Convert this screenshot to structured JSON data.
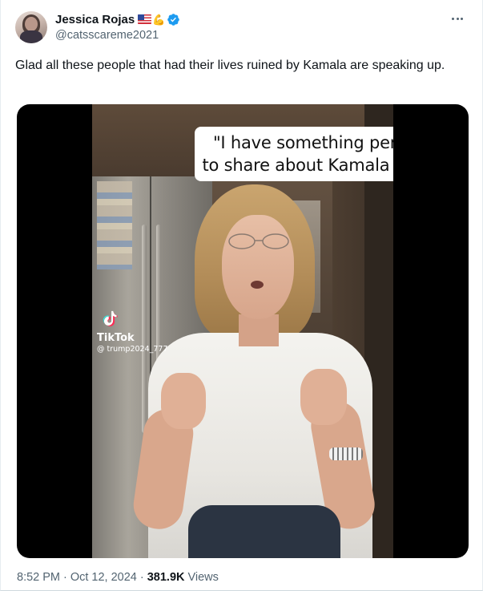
{
  "author": {
    "display_name": "Jessica Rojas",
    "handle": "@catsscareme2021",
    "emoji_badges": [
      "us-flag",
      "flexed-biceps"
    ],
    "verified": true
  },
  "tweet": {
    "text": "Glad all these people that had their lives ruined by Kamala are speaking up."
  },
  "media": {
    "type": "video",
    "caption_line_1": "\"I have something personal",
    "caption_line_2": "to share about Kamala Harris\"",
    "watermark_brand": "TikTok",
    "watermark_user": "@ trump2024_777"
  },
  "meta": {
    "time": "8:52 PM",
    "date": "Oct 12, 2024",
    "separator": "·",
    "views_count": "381.9K",
    "views_label": "Views"
  },
  "colors": {
    "text_primary": "#0f1419",
    "text_secondary": "#536471",
    "verified_blue": "#1d9bf0"
  },
  "icons": {
    "more": "more-horizontal-icon",
    "verified": "verified-badge-icon",
    "tiktok": "tiktok-logo-icon"
  }
}
